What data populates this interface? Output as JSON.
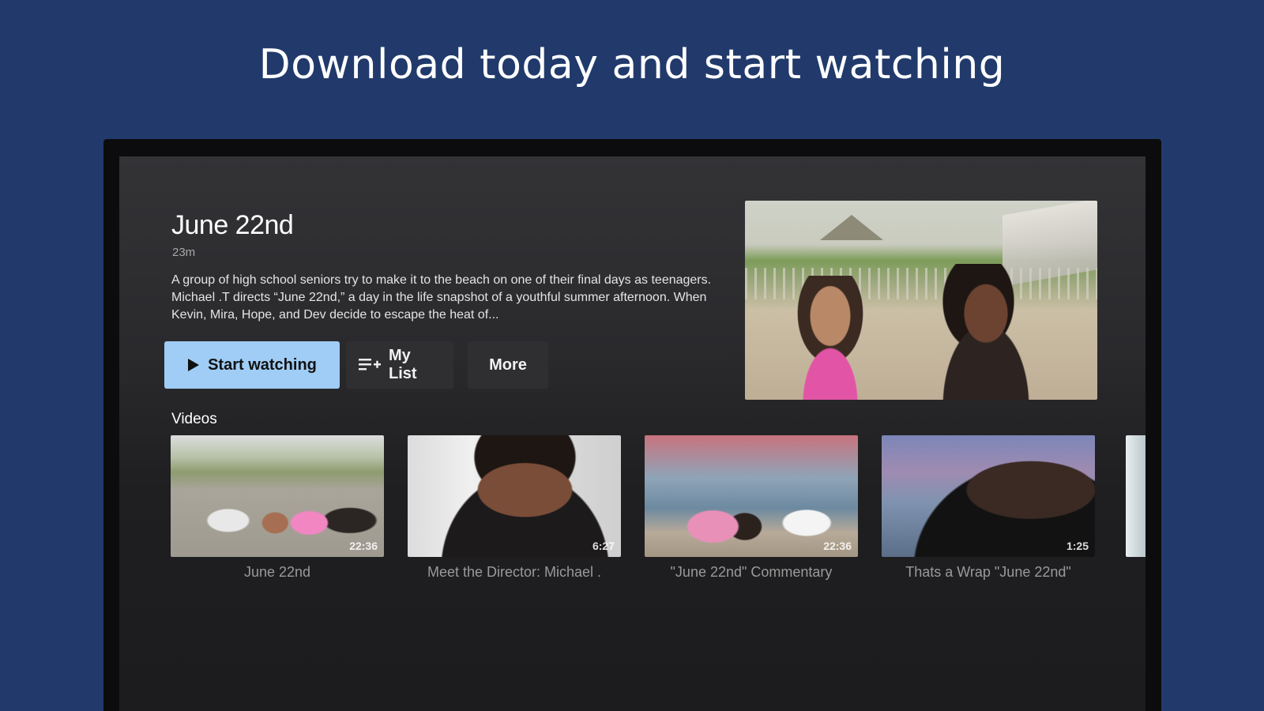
{
  "promo": {
    "headline": "Download today and start watching"
  },
  "detail": {
    "title": "June 22nd",
    "duration": "23m",
    "description": "A group of high school seniors try to make it to the beach on one of their final days as teenagers. Michael .T directs “June 22nd,” a day in the life snapshot of a youthful summer afternoon. When Kevin, Mira, Hope, and Dev decide to escape the heat of...",
    "buttons": {
      "start_label": "Start watching",
      "mylist_label": "My List",
      "more_label": "More"
    }
  },
  "videos": {
    "section_label": "Videos",
    "items": [
      {
        "title": "June 22nd",
        "duration": "22:36"
      },
      {
        "title": "Meet the Director: Michael .",
        "duration": "6:27"
      },
      {
        "title": "\"June 22nd\" Commentary",
        "duration": "22:36"
      },
      {
        "title": "Thats a Wrap \"June 22nd\"",
        "duration": "1:25"
      }
    ]
  },
  "colors": {
    "background": "#213a6b",
    "primary_button": "#9fcdf5"
  },
  "icons": {
    "play": "play-icon",
    "playlist_add": "playlist-add-icon"
  }
}
